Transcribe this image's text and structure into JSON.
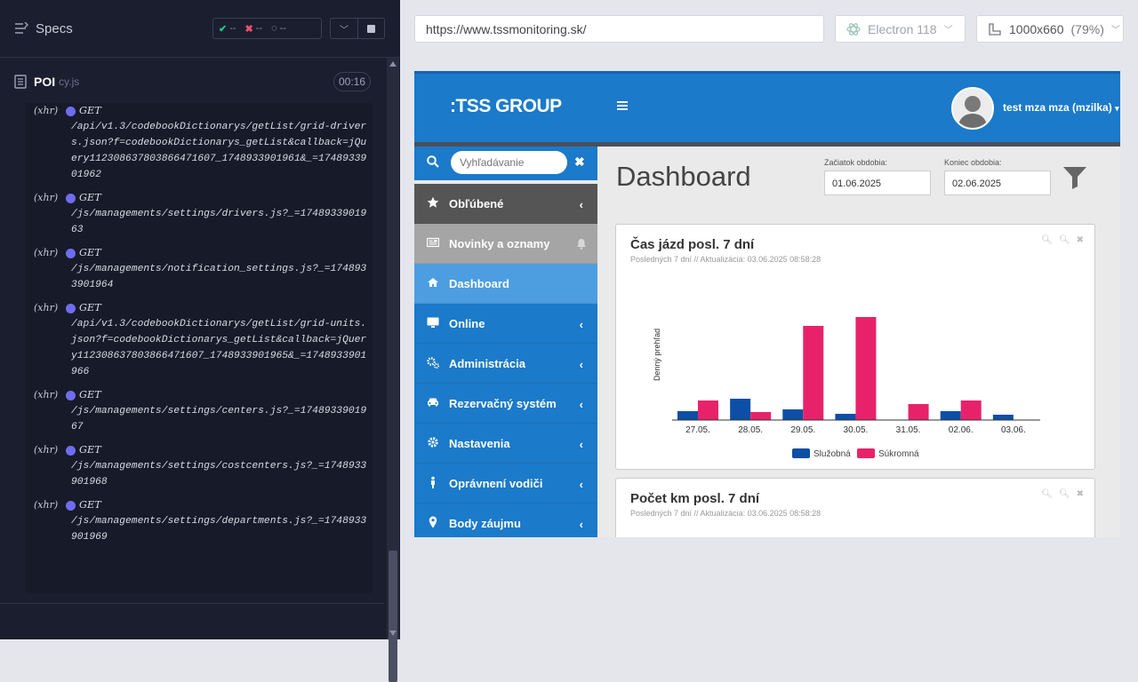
{
  "runner": {
    "title": "Specs",
    "status": {
      "passed": "--",
      "failed": "--",
      "pending": "--"
    },
    "spec": {
      "name": "POI",
      "ext": "cy.js",
      "time": "00:16"
    },
    "log": [
      {
        "type": "(xhr)",
        "method": "GET",
        "url": "/api/v1.3/codebookDictionarys/getList/grid-drivers.json?f=codebookDictionarys_getList&callback=jQuery112308637803866471607_1748933901961&_=1748933901962"
      },
      {
        "type": "(xhr)",
        "method": "GET",
        "url": "/js/managements/settings/drivers.js?_=1748933901963"
      },
      {
        "type": "(xhr)",
        "method": "GET",
        "url": "/js/managements/notification_settings.js?_=1748933901964"
      },
      {
        "type": "(xhr)",
        "method": "GET",
        "url": "/api/v1.3/codebookDictionarys/getList/grid-units.json?f=codebookDictionarys_getList&callback=jQuery112308637803866471607_1748933901965&_=1748933901966"
      },
      {
        "type": "(xhr)",
        "method": "GET",
        "url": "/js/managements/settings/centers.js?_=1748933901967"
      },
      {
        "type": "(xhr)",
        "method": "GET",
        "url": "/js/managements/settings/costcenters.js?_=1748933901968"
      },
      {
        "type": "(xhr)",
        "method": "GET",
        "url": "/js/managements/settings/departments.js?_=1748933901969"
      }
    ]
  },
  "browser": {
    "url": "https://www.tssmonitoring.sk/",
    "engine": "Electron 118",
    "viewport": "1000x660",
    "zoom": "(79%)"
  },
  "app": {
    "logo": ":TSS GROUP",
    "user": "test mza mza (mzilka)",
    "search_placeholder": "Vyhľadávanie",
    "nav": [
      {
        "label": "Obľúbené",
        "icon": "star-icon"
      },
      {
        "label": "Novinky a oznamy",
        "icon": "newspaper-icon"
      },
      {
        "label": "Dashboard",
        "icon": "home-icon"
      },
      {
        "label": "Online",
        "icon": "monitor-icon"
      },
      {
        "label": "Administrácia",
        "icon": "cogs-icon"
      },
      {
        "label": "Rezervačný systém",
        "icon": "car-icon"
      },
      {
        "label": "Nastavenia",
        "icon": "gear-icon"
      },
      {
        "label": "Oprávnení vodiči",
        "icon": "person-icon"
      },
      {
        "label": "Body záujmu",
        "icon": "map-marker-icon"
      }
    ],
    "page_title": "Dashboard",
    "period_start_label": "Začiatok obdobia:",
    "period_start": "01.06.2025",
    "period_end_label": "Koniec obdobia:",
    "period_end": "02.06.2025",
    "cards": [
      {
        "title": "Čas jázd posl. 7 dní",
        "subtitle": "Posledných 7 dní // Aktualizácia: 03.06.2025 08:58:28"
      },
      {
        "title": "Počet km posl. 7 dní",
        "subtitle": "Posledných 7 dní // Aktualizácia: 03.06.2025 08:58:28"
      }
    ]
  },
  "chart_data": {
    "type": "bar",
    "categories": [
      "27.05.",
      "28.05.",
      "29.05.",
      "30.05.",
      "31.05.",
      "02.06.",
      "03.06."
    ],
    "series": [
      {
        "name": "Služobná",
        "color": "#0d4fa6",
        "values": [
          10,
          24,
          12,
          7,
          0,
          10,
          6
        ]
      },
      {
        "name": "Súkromná",
        "color": "#e8226a",
        "values": [
          22,
          9,
          106,
          116,
          18,
          22,
          0
        ]
      }
    ],
    "ylabel": "Denný prehľad",
    "xlabel": "",
    "ylim": [
      0,
      120
    ],
    "legend": "bottom"
  }
}
